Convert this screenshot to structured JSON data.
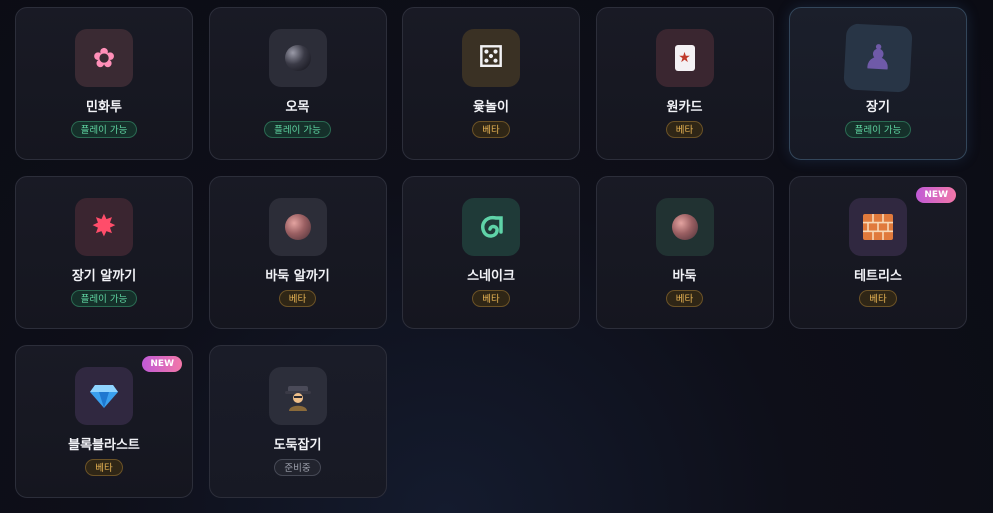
{
  "games": [
    {
      "title": "민화투",
      "status": "플레이 가능",
      "icon": "cherry-blossom-icon",
      "glyph": "🌸",
      "icon_bg": "#3a2a33"
    },
    {
      "title": "오목",
      "status": "플레이 가능",
      "icon": "go-stone-icon",
      "glyph": "",
      "icon_bg": "#2c2d38"
    },
    {
      "title": "윷놀이",
      "status": "베타",
      "icon": "dice-icon",
      "glyph": "🎲",
      "icon_bg": "#3a3124"
    },
    {
      "title": "원카드",
      "status": "베타",
      "icon": "joker-card-icon",
      "glyph": "🃏",
      "icon_bg": "#3a2630"
    },
    {
      "title": "장기",
      "status": "플레이 가능",
      "icon": "chess-pawn-icon",
      "glyph": "♟",
      "icon_bg": "#283546"
    },
    {
      "title": "장기 알까기",
      "status": "플레이 가능",
      "icon": "collision-icon",
      "glyph": "💥",
      "icon_bg": "#3a2530"
    },
    {
      "title": "바둑 알까기",
      "status": "베타",
      "icon": "stone-icon",
      "glyph": "",
      "icon_bg": "#2c2d38"
    },
    {
      "title": "스네이크",
      "status": "베타",
      "icon": "snake-icon",
      "glyph": "〰",
      "icon_bg": "#1f3a38"
    },
    {
      "title": "바둑",
      "status": "베타",
      "icon": "stone-icon",
      "glyph": "",
      "icon_bg": "#213232"
    },
    {
      "title": "테트리스",
      "status": "베타",
      "icon": "brick-icon",
      "glyph": "🧱",
      "icon_bg": "#302840",
      "new": "NEW"
    },
    {
      "title": "블록블라스트",
      "status": "베타",
      "icon": "gem-icon",
      "glyph": "💎",
      "icon_bg": "#302840",
      "new": "NEW"
    },
    {
      "title": "도둑잡기",
      "status": "준비중",
      "icon": "detective-icon",
      "glyph": "🕵",
      "icon_bg": "#2c2e3a"
    }
  ]
}
